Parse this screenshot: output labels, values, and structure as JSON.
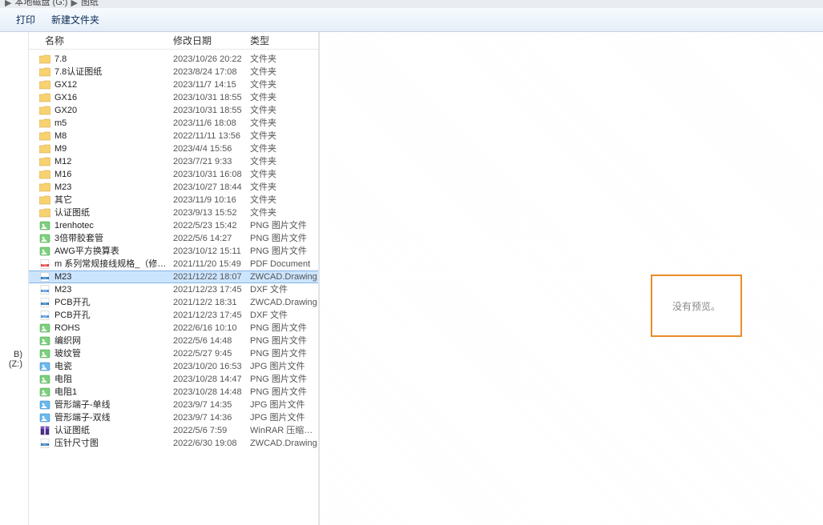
{
  "breadcrumb": {
    "sep": "▶",
    "item1": "本地磁盘 (G:)",
    "item2": "图纸"
  },
  "toolbar": {
    "print": "打印",
    "new_folder": "新建文件夹"
  },
  "columns": {
    "name": "名称",
    "date": "修改日期",
    "type": "类型"
  },
  "left_drive": "B) (Z:)",
  "preview_text": "没有预览。",
  "files": [
    {
      "icon": "folder",
      "name": "7.8",
      "date": "2023/10/26 20:22",
      "type": "文件夹"
    },
    {
      "icon": "folder",
      "name": "7.8认证图纸",
      "date": "2023/8/24 17:08",
      "type": "文件夹"
    },
    {
      "icon": "folder",
      "name": "GX12",
      "date": "2023/11/7 14:15",
      "type": "文件夹"
    },
    {
      "icon": "folder",
      "name": "GX16",
      "date": "2023/10/31 18:55",
      "type": "文件夹"
    },
    {
      "icon": "folder",
      "name": "GX20",
      "date": "2023/10/31 18:55",
      "type": "文件夹"
    },
    {
      "icon": "folder",
      "name": "m5",
      "date": "2023/11/6 18:08",
      "type": "文件夹"
    },
    {
      "icon": "folder",
      "name": "M8",
      "date": "2022/11/11 13:56",
      "type": "文件夹"
    },
    {
      "icon": "folder",
      "name": "M9",
      "date": "2023/4/4 15:56",
      "type": "文件夹"
    },
    {
      "icon": "folder",
      "name": "M12",
      "date": "2023/7/21 9:33",
      "type": "文件夹"
    },
    {
      "icon": "folder",
      "name": "M16",
      "date": "2023/10/31 16:08",
      "type": "文件夹"
    },
    {
      "icon": "folder",
      "name": "M23",
      "date": "2023/10/27 18:44",
      "type": "文件夹"
    },
    {
      "icon": "folder",
      "name": "其它",
      "date": "2023/11/9 10:16",
      "type": "文件夹"
    },
    {
      "icon": "folder",
      "name": "认证图纸",
      "date": "2023/9/13 15:52",
      "type": "文件夹"
    },
    {
      "icon": "png",
      "name": "1renhotec",
      "date": "2022/5/23 15:42",
      "type": "PNG 图片文件"
    },
    {
      "icon": "png",
      "name": "3倍带胶套管",
      "date": "2022/5/6 14:27",
      "type": "PNG 图片文件"
    },
    {
      "icon": "png",
      "name": "AWG平方换算表",
      "date": "2023/10/12 15:11",
      "type": "PNG 图片文件"
    },
    {
      "icon": "pdf",
      "name": "m 系列常规接线规格_（修订版）",
      "date": "2021/11/20 15:49",
      "type": "PDF Document"
    },
    {
      "icon": "dwg",
      "name": "M23",
      "date": "2021/12/22 18:07",
      "type": "ZWCAD.Drawing",
      "selected": true
    },
    {
      "icon": "dxf",
      "name": "M23",
      "date": "2021/12/23 17:45",
      "type": "DXF 文件"
    },
    {
      "icon": "dwg",
      "name": "PCB开孔",
      "date": "2021/12/2 18:31",
      "type": "ZWCAD.Drawing"
    },
    {
      "icon": "dxf",
      "name": "PCB开孔",
      "date": "2021/12/23 17:45",
      "type": "DXF 文件"
    },
    {
      "icon": "png",
      "name": "ROHS",
      "date": "2022/6/16 10:10",
      "type": "PNG 图片文件"
    },
    {
      "icon": "png",
      "name": "编织网",
      "date": "2022/5/6 14:48",
      "type": "PNG 图片文件"
    },
    {
      "icon": "png",
      "name": "玻纹管",
      "date": "2022/5/27 9:45",
      "type": "PNG 图片文件"
    },
    {
      "icon": "jpg",
      "name": "电瓷",
      "date": "2023/10/20 16:53",
      "type": "JPG 图片文件"
    },
    {
      "icon": "png",
      "name": "电阻",
      "date": "2023/10/28 14:47",
      "type": "PNG 图片文件"
    },
    {
      "icon": "png",
      "name": "电阻1",
      "date": "2023/10/28 14:48",
      "type": "PNG 图片文件"
    },
    {
      "icon": "jpg",
      "name": "管形端子-单线",
      "date": "2023/9/7 14:35",
      "type": "JPG 图片文件"
    },
    {
      "icon": "jpg",
      "name": "管形端子-双线",
      "date": "2023/9/7 14:36",
      "type": "JPG 图片文件"
    },
    {
      "icon": "rar",
      "name": "认证图纸",
      "date": "2022/5/6 7:59",
      "type": "WinRAR 压缩文…"
    },
    {
      "icon": "dwg",
      "name": "压针尺寸图",
      "date": "2022/6/30 19:08",
      "type": "ZWCAD.Drawing"
    }
  ]
}
